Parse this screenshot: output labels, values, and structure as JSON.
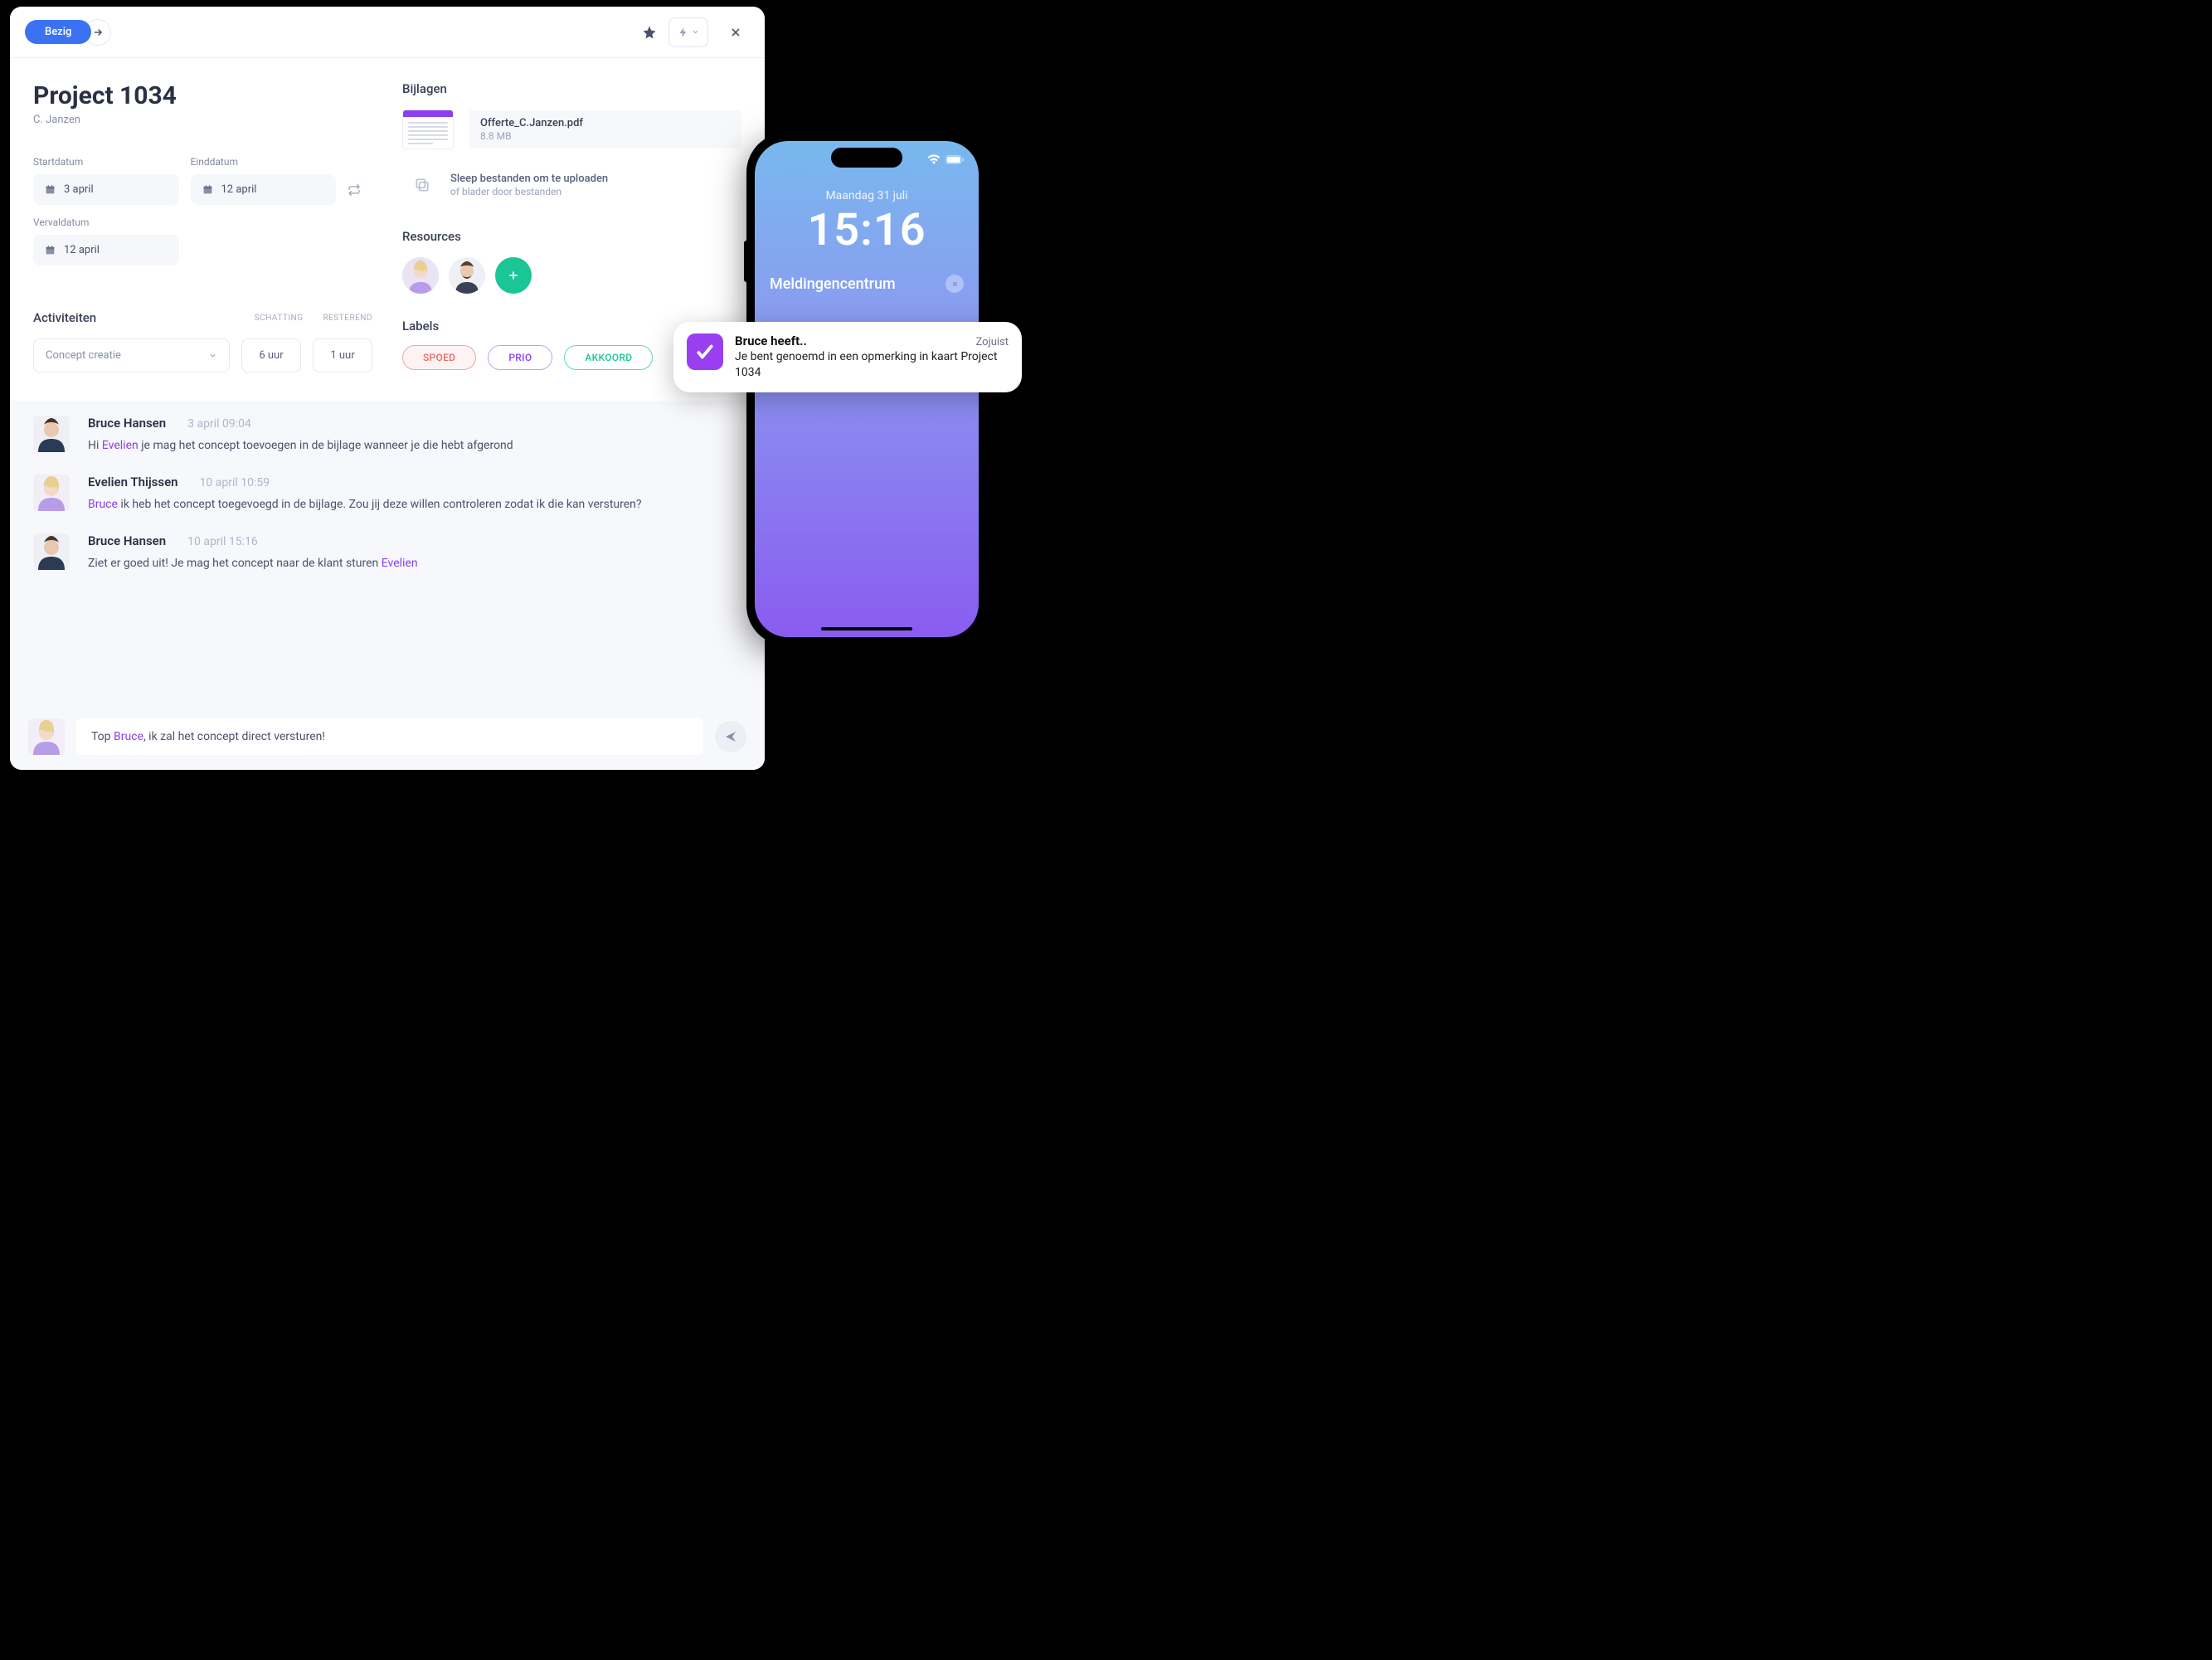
{
  "header": {
    "status": "Bezig"
  },
  "project": {
    "title": "Project 1034",
    "client": "C. Janzen"
  },
  "dates": {
    "start_label": "Startdatum",
    "start_value": "3 april",
    "end_label": "Einddatum",
    "end_value": "12 april",
    "due_label": "Vervaldatum",
    "due_value": "12 april"
  },
  "activities": {
    "title": "Activiteiten",
    "col_estimate": "SCHATTING",
    "col_remaining": "RESTEREND",
    "select_value": "Concept creatie",
    "estimate_value": "6 uur",
    "remaining_value": "1 uur"
  },
  "attachments": {
    "title": "Bijlagen",
    "file_name": "Offerte_C.Janzen.pdf",
    "file_size": "8.8 MB",
    "dz_title": "Sleep bestanden om te uploaden",
    "dz_sub": "of blader door bestanden"
  },
  "resources": {
    "title": "Resources"
  },
  "labels": {
    "title": "Labels",
    "spoed": "SPOED",
    "prio": "PRIO",
    "akkoord": "AKKOORD"
  },
  "comments": [
    {
      "author": "Bruce Hansen",
      "time": "3 april 09:04",
      "prefix": "Hi ",
      "mention": "Evelien",
      "suffix": " je mag het concept toevoegen in de bijlage wanneer je die hebt afgerond"
    },
    {
      "author": "Evelien Thijssen",
      "time": "10 april 10:59",
      "prefix": "",
      "mention": "Bruce",
      "suffix": " ik heb het concept toegevoegd in de bijlage. Zou jij deze willen controleren zodat ik die kan versturen?"
    },
    {
      "author": "Bruce Hansen",
      "time": "10 april 15:16",
      "prefix": "Ziet er goed uit! Je mag het concept naar de klant sturen ",
      "mention": "Evelien",
      "suffix": ""
    }
  ],
  "composer": {
    "prefix": "Top ",
    "mention": "Bruce",
    "suffix": ", ik zal het concept direct versturen!"
  },
  "phone": {
    "date": "Maandag 31 juli",
    "time": "15:16",
    "nc_title": "Meldingencentrum"
  },
  "notification": {
    "title": "Bruce heeft..",
    "time": "Zojuist",
    "body": "Je bent genoemd in een opmerking in kaart Project 1034"
  }
}
